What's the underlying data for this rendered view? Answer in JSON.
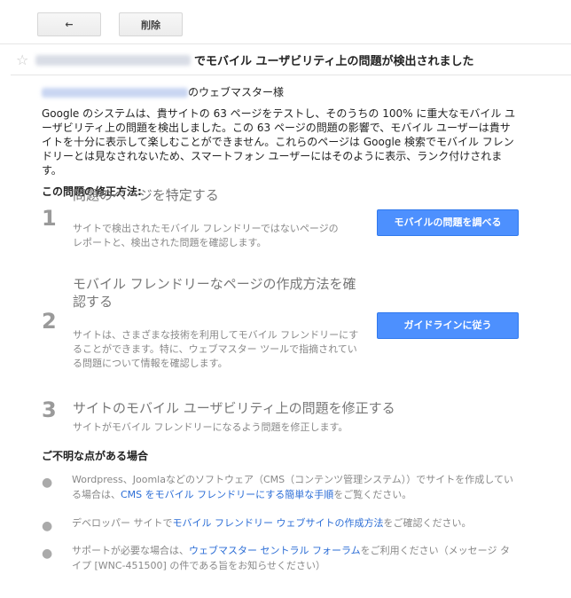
{
  "toolbar": {
    "back_icon": "←",
    "delete_label": "削除"
  },
  "header": {
    "star_icon": "☆",
    "subject_suffix": "でモバイル ユーザビリティ上の問題が検出されました"
  },
  "email": {
    "greeting_suffix": "のウェブマスター様",
    "intro": "Google のシステムは、貴サイトの 63 ページをテストし、そのうちの 100% に重大なモバイル ユーザビリティ上の問題を検出しました。この 63 ページの問題の影響で、モバイル ユーザーは貴サイトを十分に表示して楽しむことができません。これらのページは Google 検索でモバイル フレンドリーとは見なされないため、スマートフォン ユーザーにはそのように表示、ランク付けされます。",
    "fix_title": "この問題の修正方法:",
    "steps": [
      {
        "num": "1",
        "title": "問題のページを特定する",
        "desc": "サイトで検出されたモバイル フレンドリーではないページのレポートと、検出された問題を確認します。",
        "button": "モバイルの問題を調べる"
      },
      {
        "num": "2",
        "title": "モバイル フレンドリーなページの作成方法を確認する",
        "desc": "サイトは、さまざまな技術を利用してモバイル フレンドリーにすることができます。特に、ウェブマスター ツールで指摘されている問題について情報を確認します。",
        "button": "ガイドラインに従う"
      },
      {
        "num": "3",
        "title": "サイトのモバイル ユーザビリティ上の問題を修正する",
        "desc": "サイトがモバイル フレンドリーになるよう問題を修正します。"
      }
    ],
    "help_title": "ご不明な点がある場合",
    "help": [
      {
        "before": "Wordpress、Joomlaなどのソフトウェア（CMS（コンテンツ管理システム））でサイトを作成している場合は、",
        "link": "CMS をモバイル フレンドリーにする簡単な手順",
        "after": "をご覧ください。"
      },
      {
        "before": "デベロッパー サイトで",
        "link": "モバイル フレンドリー ウェブサイトの作成方法",
        "after": "をご確認ください。"
      },
      {
        "before": "サポートが必要な場合は、",
        "link": "ウェブマスター セントラル フォーラム",
        "after": "をご利用ください（メッセージ タイプ [WNC-451500] の件である旨をお知らせください）"
      }
    ]
  }
}
